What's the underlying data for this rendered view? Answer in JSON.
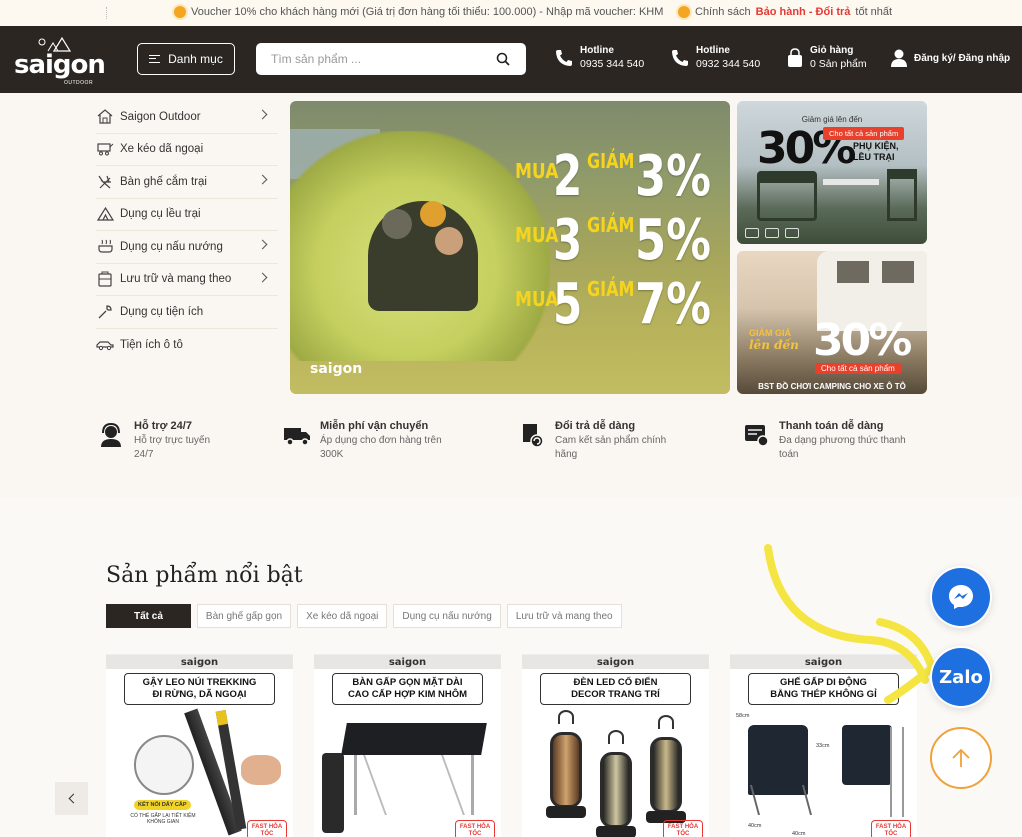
{
  "announcement": {
    "voucher": "Voucher 10% cho khách hàng mới (Giá trị đơn hàng tối thiểu: 100.000) - Nhập mã voucher: KHM",
    "policy_prefix": "Chính sách",
    "policy_highlight": "Bảo hành - Đổi trả",
    "policy_suffix": "tốt nhất"
  },
  "header": {
    "logo_name": "saigon",
    "logo_sub": "OUTDOOR",
    "category_button": "Danh mục",
    "search_placeholder": "Tìm sản phẩm ...",
    "hotline1_label": "Hotline",
    "hotline1_value": "0935 344 540",
    "hotline2_label": "Hotline",
    "hotline2_value": "0932 344 540",
    "cart_label": "Giỏ hàng",
    "cart_value": "0 Sản phẩm",
    "account": "Đăng ký/ Đăng nhập"
  },
  "sidebar": {
    "items": [
      {
        "label": "Saigon Outdoor",
        "icon": "home-icon",
        "has_submenu": true
      },
      {
        "label": "Xe kéo dã ngoại",
        "icon": "cart-wagon-icon",
        "has_submenu": false
      },
      {
        "label": "Bàn ghế cắm trại",
        "icon": "chair-icon",
        "has_submenu": true
      },
      {
        "label": "Dụng cụ lều trại",
        "icon": "tent-icon",
        "has_submenu": false
      },
      {
        "label": "Dụng cụ nấu nướng",
        "icon": "cooking-icon",
        "has_submenu": true
      },
      {
        "label": "Lưu trữ và mang theo",
        "icon": "storage-icon",
        "has_submenu": true
      },
      {
        "label": "Dụng cụ tiện ích",
        "icon": "tool-icon",
        "has_submenu": false
      },
      {
        "label": "Tiện ích ô tô",
        "icon": "car-icon",
        "has_submenu": false
      }
    ]
  },
  "hero": {
    "rows": [
      {
        "mua": "MUA",
        "num": "2",
        "giam": "GIẢM",
        "pct": "3%"
      },
      {
        "mua": "MUA",
        "num": "3",
        "giam": "GIẢM",
        "pct": "5%"
      },
      {
        "mua": "MUA",
        "num": "5",
        "giam": "GIẢM",
        "pct": "7%"
      }
    ],
    "logo": "saigon"
  },
  "side_banner1": {
    "top": "Giảm giá lên đến",
    "big": "30%",
    "tag": "Cho tất cả sản phẩm",
    "label_line1": "PHỤ KIỆN,",
    "label_line2": "LỀU TRẠI"
  },
  "side_banner2": {
    "gl_line1": "GIẢM GIÁ",
    "gl_line2": "lên đến",
    "big": "30%",
    "tag": "Cho tất cả sản phẩm",
    "foot": "BST ĐỒ CHƠI CAMPING CHO XE Ô TÔ"
  },
  "features": [
    {
      "title": "Hỗ trợ 24/7",
      "desc": "Hỗ trợ trực tuyến 24/7",
      "icon": "support-icon"
    },
    {
      "title": "Miễn phí vận chuyển",
      "desc": "Áp dụng cho đơn hàng trên 300K",
      "icon": "truck-icon"
    },
    {
      "title": "Đổi trả dễ dàng",
      "desc": "Cam kết sản phẩm chính hãng",
      "icon": "return-icon"
    },
    {
      "title": "Thanh toán dễ dàng",
      "desc": "Đa dạng phương thức thanh toán",
      "icon": "payment-icon"
    }
  ],
  "featured": {
    "title": "Sản phẩm nổi bật",
    "tabs": [
      "Tất cả",
      "Bàn ghế gấp gọn",
      "Xe kéo dã ngoại",
      "Dụng cụ nấu nướng",
      "Lưu trữ và mang theo"
    ],
    "products": [
      {
        "logo": "saigon",
        "title_l1": "GẬY LEO NÚI TREKKING",
        "title_l2": "ĐI RỪNG, DÃ NGOẠI",
        "note": "KẾT NỐI DÂY CẦP",
        "note2": "CÓ THỂ GẤP LẠI TIẾT KIỆM KHÔNG GIAN"
      },
      {
        "logo": "saigon",
        "title_l1": "BÀN GẤP GỌN MẶT DÀI",
        "title_l2": "CAO CẤP HỢP KIM NHÔM"
      },
      {
        "logo": "saigon",
        "title_l1": "ĐÈN LED CỔ ĐIỂN",
        "title_l2": "DECOR TRANG TRÍ"
      },
      {
        "logo": "saigon",
        "title_l1": "GHẾ GẤP DI ĐỘNG",
        "title_l2": "BẰNG THÉP KHÔNG GỈ",
        "dim1": "58cm",
        "dim2": "33cm",
        "dim3": "40cm",
        "dim4": "40cm"
      }
    ],
    "fast_badge": "FAST HỎA TỐC"
  },
  "floating": {
    "zalo": "Zalo"
  },
  "colors": {
    "header_bg": "#2b2622",
    "accent_red": "#e53935",
    "promo_yellow": "#f5d31f",
    "messenger_blue": "#1e6fe0",
    "totop_orange": "#f0a13c",
    "annotation_yellow": "#f4e542"
  }
}
